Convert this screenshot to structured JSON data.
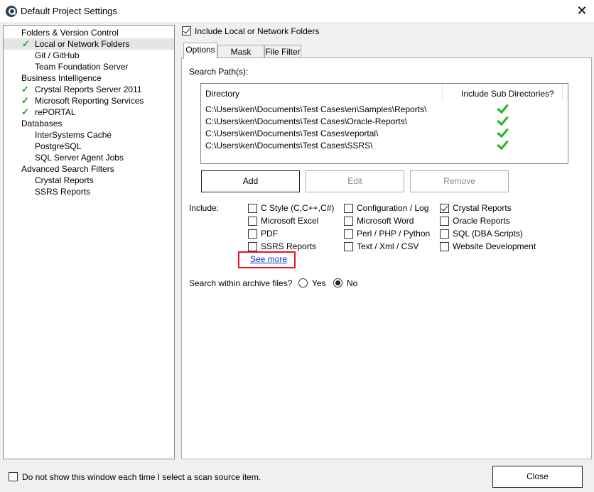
{
  "window": {
    "title": "Default Project Settings",
    "close_glyph": "✕"
  },
  "tree": {
    "items": [
      {
        "label": "Folders & Version Control",
        "level": 0,
        "checked": false
      },
      {
        "label": "Local or Network Folders",
        "level": 1,
        "checked": true,
        "selected": true
      },
      {
        "label": "Git / GitHub",
        "level": 1,
        "checked": false
      },
      {
        "label": "Team Foundation Server",
        "level": 1,
        "checked": false
      },
      {
        "label": "Business Intelligence",
        "level": 0,
        "checked": false
      },
      {
        "label": "Crystal Reports Server 2011",
        "level": 1,
        "checked": true
      },
      {
        "label": "Microsoft Reporting Services",
        "level": 1,
        "checked": true
      },
      {
        "label": "rePORTAL",
        "level": 1,
        "checked": true
      },
      {
        "label": "Databases",
        "level": 0,
        "checked": false
      },
      {
        "label": "InterSystems Caché",
        "level": 1,
        "checked": false
      },
      {
        "label": "PostgreSQL",
        "level": 1,
        "checked": false
      },
      {
        "label": "SQL Server Agent Jobs",
        "level": 1,
        "checked": false
      },
      {
        "label": "Advanced Search Filters",
        "level": 0,
        "checked": false
      },
      {
        "label": "Crystal Reports",
        "level": 1,
        "checked": false
      },
      {
        "label": "SSRS Reports",
        "level": 1,
        "checked": false
      }
    ],
    "check_glyph": "✓"
  },
  "include_folders": {
    "label": "Include Local or Network Folders",
    "checked": true
  },
  "tabs": [
    {
      "label": "Options",
      "active": true
    },
    {
      "label": "Mask Filters",
      "active": false
    },
    {
      "label": "File Filter",
      "active": false
    }
  ],
  "options": {
    "search_paths_label": "Search Path(s):",
    "columns": {
      "directory": "Directory",
      "subdirs": "Include Sub Directories?"
    },
    "paths": [
      {
        "directory": "C:\\Users\\ken\\Documents\\Test Cases\\en\\Samples\\Reports\\",
        "subdirs": true
      },
      {
        "directory": "C:\\Users\\ken\\Documents\\Test Cases\\Oracle-Reports\\",
        "subdirs": true
      },
      {
        "directory": "C:\\Users\\ken\\Documents\\Test Cases\\reportal\\",
        "subdirs": true
      },
      {
        "directory": "C:\\Users\\ken\\Documents\\Test Cases\\SSRS\\",
        "subdirs": true
      }
    ],
    "buttons": {
      "add": "Add",
      "edit": "Edit",
      "remove": "Remove"
    },
    "include_label": "Include:",
    "include": {
      "c_style": {
        "label": "C Style (C,C++,C#)",
        "checked": false
      },
      "configuration_log": {
        "label": "Configuration / Log",
        "checked": false
      },
      "crystal_reports": {
        "label": "Crystal Reports",
        "checked": true
      },
      "microsoft_excel": {
        "label": "Microsoft Excel",
        "checked": false
      },
      "microsoft_word": {
        "label": "Microsoft Word",
        "checked": false
      },
      "oracle_reports": {
        "label": "Oracle Reports",
        "checked": false
      },
      "pdf": {
        "label": "PDF",
        "checked": false
      },
      "perl_php_python": {
        "label": "Perl / PHP / Python",
        "checked": false
      },
      "sql_dba_scripts": {
        "label": "SQL (DBA Scripts)",
        "checked": false
      },
      "ssrs_reports": {
        "label": "SSRS Reports",
        "checked": false
      },
      "text_xml_csv": {
        "label": "Text / Xml / CSV",
        "checked": false
      },
      "website_development": {
        "label": "Website Development",
        "checked": false
      }
    },
    "see_more": "See more",
    "archive": {
      "label": "Search within archive files?",
      "yes": "Yes",
      "no": "No",
      "selected": "No"
    }
  },
  "footer": {
    "dont_show_label": "Do not show this window each time I select a scan source item.",
    "dont_show_checked": false,
    "close_label": "Close"
  }
}
